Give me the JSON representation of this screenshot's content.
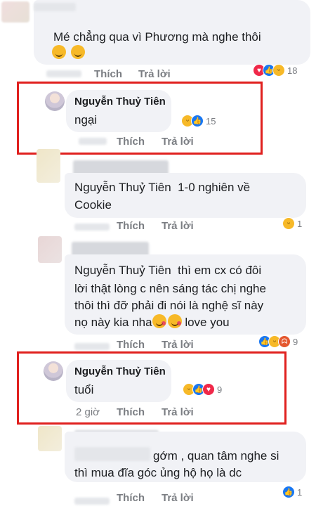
{
  "comments": [
    {
      "text": "Mé chẳng qua vì Phương mà nghe thôi",
      "actions": {
        "like": "Thích",
        "reply": "Trả lời"
      },
      "reaction_count": "18"
    },
    {
      "author": "Nguyễn Thuỷ Tiên",
      "text": "ngại",
      "actions": {
        "like": "Thích",
        "reply": "Trả lời"
      },
      "reaction_count": "15"
    },
    {
      "text_line1": "Nguyễn Thuỷ Tiên  1-0 nghiên về",
      "text_line2": "Cookie",
      "actions": {
        "like": "Thích",
        "reply": "Trả lời"
      },
      "reaction_count": "1"
    },
    {
      "text_line1": "Nguyễn Thuỷ Tiên  thì em cx có đôi",
      "text_line2": "lời thật lòng c nên sáng tác chị nghe",
      "text_line3": "thôi thì đỡ phải đi nói là nghệ sĩ này",
      "text_line4_prefix": "nọ này kia nha",
      "text_line4_suffix": " love you",
      "actions": {
        "like": "Thích",
        "reply": "Trả lời"
      },
      "reaction_count": "9"
    },
    {
      "author": "Nguyễn Thuỷ Tiên",
      "text": "tuổi",
      "time": "2 giờ",
      "actions": {
        "like": "Thích",
        "reply": "Trả lời"
      },
      "reaction_count": "9"
    },
    {
      "text_line1_suffix": "gớm , quan tâm nghe si",
      "text_line2": "thì mua đĩa góc ủng hộ họ là dc",
      "actions": {
        "like": "Thích",
        "reply": "Trả lời"
      },
      "reaction_count": "1"
    }
  ],
  "colors": {
    "highlight": "#e0201e",
    "bubble": "#f1f2f6",
    "like": "#1877f2",
    "love": "#f02849",
    "haha": "#f7b928"
  }
}
